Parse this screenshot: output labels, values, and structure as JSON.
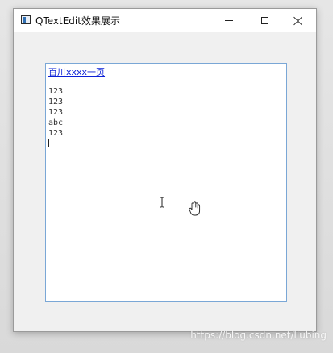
{
  "window": {
    "title": "QTextEdit效果展示"
  },
  "textedit": {
    "link_text": "百川xxxx一页",
    "lines": [
      "123",
      "123",
      "123",
      "abc",
      "123"
    ]
  },
  "watermark": "https://blog.csdn.net/liubing",
  "icons": {
    "app": "app-icon",
    "minimize": "minimize-icon",
    "maximize": "maximize-icon",
    "close": "close-icon",
    "ibeam": "ibeam-cursor-icon",
    "hand": "hand-cursor-icon"
  },
  "colors": {
    "link": "#0b1fd6",
    "editor_border": "#7aa7d6"
  }
}
